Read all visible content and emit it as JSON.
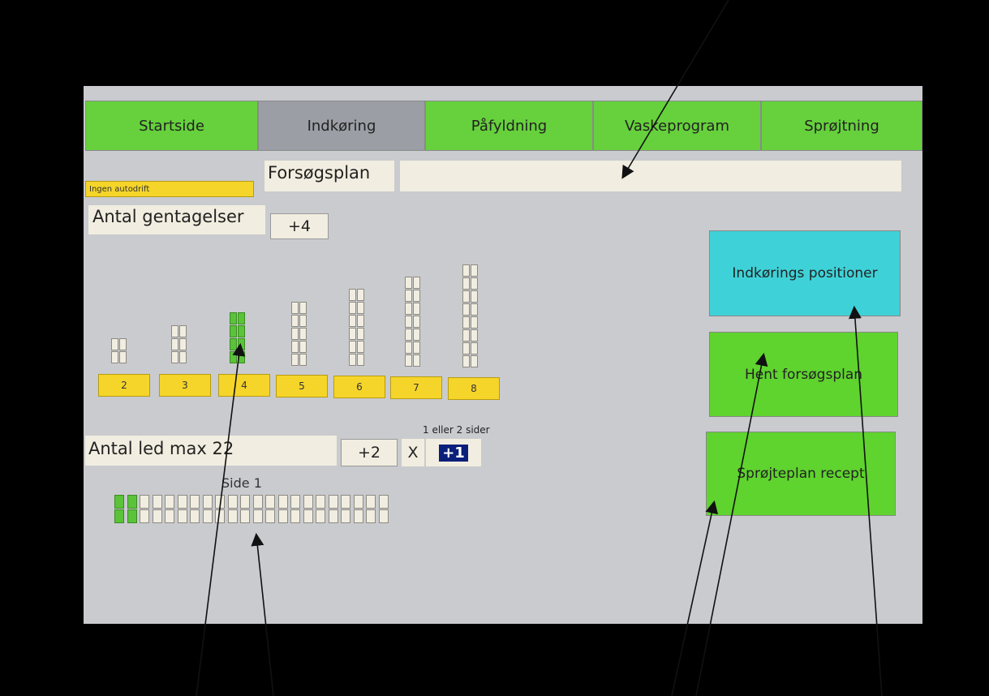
{
  "tabs": [
    {
      "label": "Startside",
      "state": "green"
    },
    {
      "label": "Indkøring",
      "state": "active"
    },
    {
      "label": "Påfyldning",
      "state": "green"
    },
    {
      "label": "Vaskeprogram",
      "state": "green"
    },
    {
      "label": "Sprøjtning",
      "state": "green"
    }
  ],
  "status": {
    "autodrift": "Ingen autodrift"
  },
  "forsogsplan": {
    "label": "Forsøgsplan",
    "value": ""
  },
  "gentagelser": {
    "label": "Antal gentagelser",
    "value": "+4"
  },
  "repetition_buttons": [
    "2",
    "3",
    "4",
    "5",
    "6",
    "7",
    "8"
  ],
  "selected_repetition": "4",
  "led": {
    "label": "Antal led max 22",
    "value": "+2",
    "multiply": "X",
    "sides_caption": "1 eller 2 sider",
    "sides_value": "+1",
    "side_label": "Side 1",
    "max": 22,
    "active": 2
  },
  "actions": {
    "positions": "Indkørings positioner",
    "fetch_plan": "Hent forsøgsplan",
    "spray_recipe": "Sprøjteplan recept"
  },
  "colors": {
    "tab_green": "#66d13c",
    "tab_active": "#9b9ea5",
    "cyan": "#3ed2d8",
    "yellow": "#f5d52a",
    "screen_bg": "#c9cbcf"
  }
}
